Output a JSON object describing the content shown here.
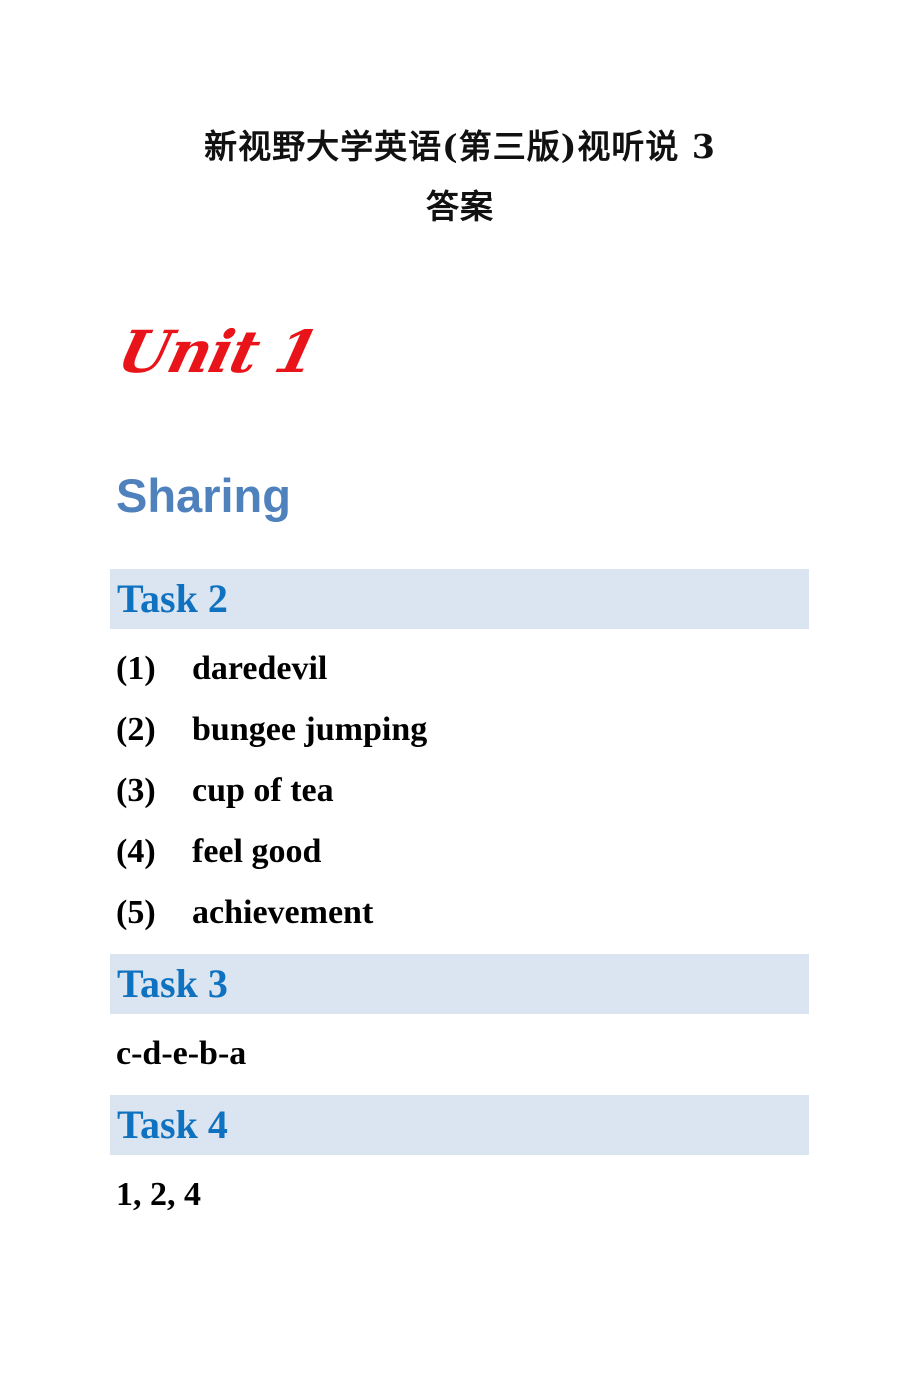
{
  "document": {
    "title_line1": "新视野大学英语(第三版)视听说 3",
    "title_line2": "答案"
  },
  "unit": {
    "heading": "Unit 1",
    "color": "#e8141a"
  },
  "section": {
    "heading": "Sharing",
    "color": "#4f81bd"
  },
  "tasks": [
    {
      "label": "Task 2",
      "answers": [
        {
          "num": "(1)",
          "text": "daredevil"
        },
        {
          "num": "(2)",
          "text": "bungee jumping"
        },
        {
          "num": "(3)",
          "text": "cup of tea"
        },
        {
          "num": "(4)",
          "text": "feel good"
        },
        {
          "num": "(5)",
          "text": "achievement"
        }
      ]
    },
    {
      "label": "Task 3",
      "answer": "c-d-e-b-a"
    },
    {
      "label": "Task 4",
      "answer": "1, 2, 4"
    }
  ],
  "colors": {
    "task_bar_bg": "#dbe5f1",
    "task_label": "#0f72c0"
  }
}
